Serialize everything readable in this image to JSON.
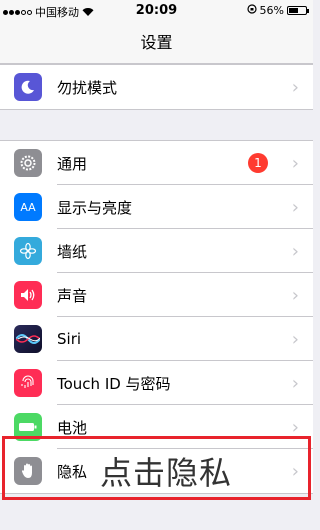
{
  "status_bar": {
    "carrier": "中国移动",
    "time": "20:09",
    "battery_percent": "56%",
    "battery_level": 0.56
  },
  "nav": {
    "title": "设置"
  },
  "group1": {
    "items": [
      {
        "label": "勿扰模式",
        "icon": "moon-icon",
        "color": "#5856d6"
      }
    ]
  },
  "group2": {
    "items": [
      {
        "label": "通用",
        "icon": "gear-icon",
        "color": "#8e8e93",
        "badge": "1"
      },
      {
        "label": "显示与亮度",
        "icon": "text-size-icon",
        "color": "#007aff",
        "icon_text": "AA"
      },
      {
        "label": "墙纸",
        "icon": "flower-icon",
        "color": "#34aadc"
      },
      {
        "label": "声音",
        "icon": "speaker-icon",
        "color": "#ff2d55"
      },
      {
        "label": "Siri",
        "icon": "siri-icon",
        "color": "#1c1c3a"
      },
      {
        "label": "Touch ID 与密码",
        "icon": "fingerprint-icon",
        "color": "#ff2d55"
      },
      {
        "label": "电池",
        "icon": "battery-icon",
        "color": "#4cd964"
      },
      {
        "label": "隐私",
        "icon": "hand-icon",
        "color": "#8e8e93"
      }
    ]
  },
  "annotation": {
    "text": "点击隐私",
    "highlight_color": "#e8232c"
  }
}
